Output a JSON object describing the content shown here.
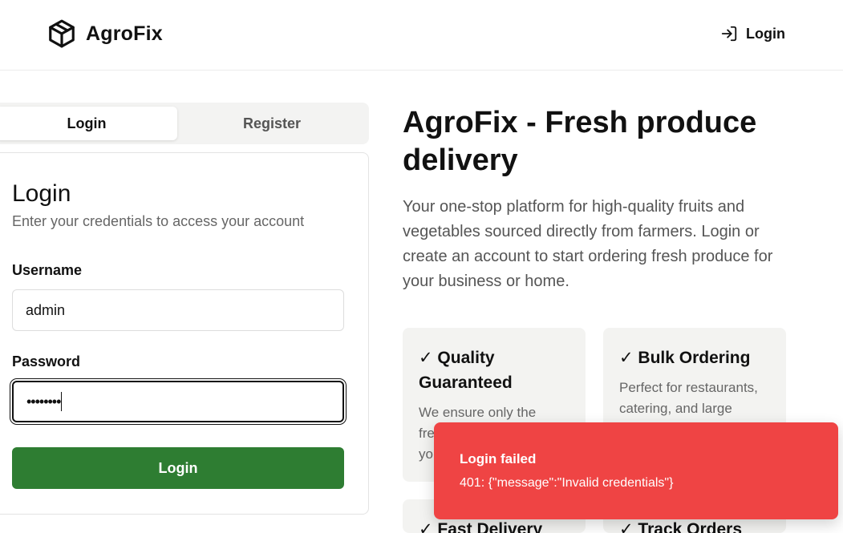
{
  "header": {
    "brand_name": "AgroFix",
    "brand_icon": "package-icon",
    "login_label": "Login",
    "login_icon": "log-in-icon"
  },
  "tabs": [
    {
      "label": "Login",
      "active": true
    },
    {
      "label": "Register",
      "active": false
    }
  ],
  "login_form": {
    "title": "Login",
    "subtitle": "Enter your credentials to access your account",
    "username_label": "Username",
    "username_value": "admin",
    "password_label": "Password",
    "password_value": "••••••••",
    "submit_label": "Login",
    "submit_color": "#2e7d32"
  },
  "hero": {
    "title": "AgroFix - Fresh produce delivery",
    "description": "Your one-stop platform for high-quality fruits and vegetables sourced directly from farmers. Login or create an account to start ordering fresh produce for your business or home."
  },
  "features": [
    {
      "title": "✓ Quality Guaranteed",
      "description": "We ensure only the freshest produce reaches you."
    },
    {
      "title": "✓ Bulk Ordering",
      "description": "Perfect for restaurants, catering, and large"
    },
    {
      "title": "✓ Fast Delivery",
      "description": ""
    },
    {
      "title": "✓ Track Orders",
      "description": ""
    }
  ],
  "toast": {
    "title": "Login failed",
    "message": "401: {\"message\":\"Invalid credentials\"}",
    "color": "#ef4444"
  }
}
